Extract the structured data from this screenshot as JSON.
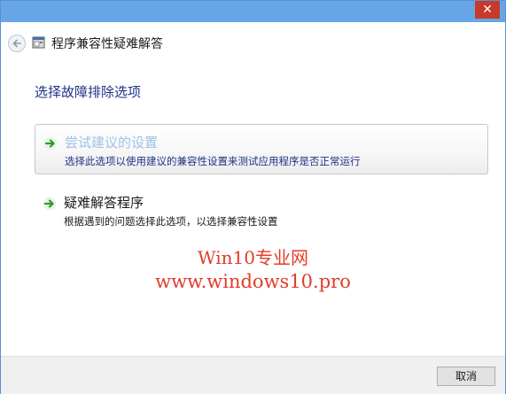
{
  "window": {
    "title": "程序兼容性疑难解答",
    "close_glyph": "✕"
  },
  "content": {
    "heading": "选择故障排除选项",
    "options": [
      {
        "title": "尝试建议的设置",
        "description": "选择此选项以使用建议的兼容性设置来测试应用程序是否正常运行",
        "selected": true
      },
      {
        "title": "疑难解答程序",
        "description": "根据遇到的问题选择此选项，以选择兼容性设置",
        "selected": false
      }
    ]
  },
  "watermark": {
    "line1": "Win10专业网",
    "line2": "www.windows10.pro"
  },
  "footer": {
    "cancel_label": "取消"
  },
  "colors": {
    "titlebar": "#66a6e6",
    "close": "#c7392a",
    "heading": "#1e3287",
    "watermark": "#e23c2a",
    "arrow": "#2e9a2e"
  },
  "icons": [
    "back-arrow-icon",
    "program-icon",
    "green-arrow-icon"
  ]
}
